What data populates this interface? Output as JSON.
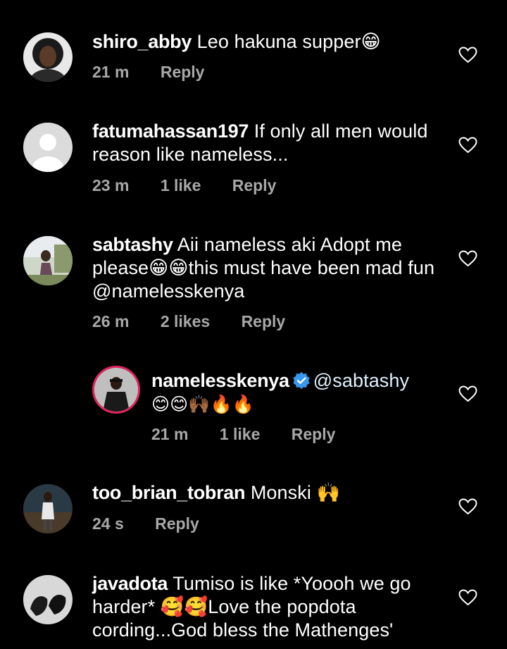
{
  "comments": [
    {
      "username": "shiro_abby",
      "text": "Leo hakuna supper😁",
      "time": "21 m",
      "likes": "",
      "reply": "Reply"
    },
    {
      "username": "fatumahassan197",
      "text": "If only all men would reason like nameless...",
      "time": "23 m",
      "likes": "1 like",
      "reply": "Reply"
    },
    {
      "username": "sabtashy",
      "text": "Aii nameless aki Adopt me please😁😁this must have been mad fun @namelesskenya",
      "time": "26 m",
      "likes": "2 likes",
      "reply": "Reply"
    },
    {
      "username": "namelesskenya",
      "mention": "@sabtashy",
      "text": "😊😊🙌🏾🔥🔥",
      "time": "21 m",
      "likes": "1 like",
      "reply": "Reply"
    },
    {
      "username": "too_brian_tobran",
      "text": "Monski 🙌",
      "time": "24 s",
      "likes": "",
      "reply": "Reply"
    },
    {
      "username": "javadota",
      "text": "Tumiso is like *Yoooh we go harder* 🥰🥰Love the popdota cording...God bless the Mathenges'",
      "time": "",
      "likes": "",
      "reply": ""
    }
  ],
  "icons": {
    "like": "heart-outline-icon",
    "verified": "verified-badge-icon"
  },
  "colors": {
    "background": "#000000",
    "text": "#ffffff",
    "meta": "#a8a8a8",
    "verified": "#3897f0",
    "story_ring": "#e0245e"
  }
}
